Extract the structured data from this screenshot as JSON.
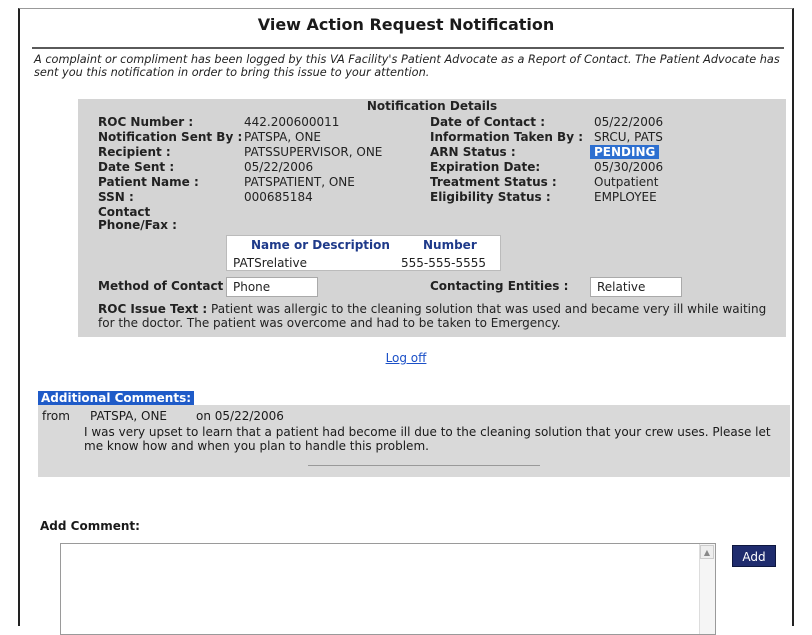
{
  "page": {
    "title": "View Action Request Notification",
    "intro": "A complaint or compliment has been logged by this VA Facility's Patient Advocate as a Report of Contact. The Patient Advocate has sent you this notification in order to bring this issue to your attention."
  },
  "details": {
    "heading": "Notification Details",
    "roc_number_label": "ROC Number :",
    "roc_number": "442.200600011",
    "sent_by_label": "Notification Sent By :",
    "sent_by": "PATSPA, ONE",
    "recipient_label": "Recipient :",
    "recipient": "PATSSUPERVISOR, ONE",
    "date_sent_label": "Date Sent :",
    "date_sent": "05/22/2006",
    "patient_name_label": "Patient Name :",
    "patient_name": "PATSPATIENT, ONE",
    "ssn_label": "SSN :",
    "ssn": "000685184",
    "contact_label_1": "Contact",
    "contact_label_2": "Phone/Fax :",
    "date_of_contact_label": "Date of Contact :",
    "date_of_contact": "05/22/2006",
    "info_taken_by_label": "Information Taken By :",
    "info_taken_by": "SRCU, PATS",
    "arn_status_label": "ARN Status :",
    "arn_status": "PENDING",
    "expiration_label": "Expiration Date:",
    "expiration": "05/30/2006",
    "treatment_label": "Treatment Status :",
    "treatment": "Outpatient",
    "eligibility_label": "Eligibility Status :",
    "eligibility": "EMPLOYEE",
    "contact_table": {
      "col_name": "Name or Description",
      "col_number": "Number",
      "name": "PATSrelative",
      "number": "555-555-5555"
    },
    "method_label": "Method of Contact :",
    "method": "Phone",
    "entities_label": "Contacting Entities :",
    "entities": "Relative",
    "issue_label": "ROC Issue Text :",
    "issue_text": " Patient was allergic to the cleaning solution that was used and became very ill while waiting for the doctor. The patient was overcome and had to be taken to Emergency."
  },
  "logoff": "Log off",
  "comments": {
    "label": "Additional Comments:",
    "from_label": "from",
    "author": "PATSPA, ONE",
    "date": "on 05/22/2006",
    "text": "I was very upset to learn that a patient had become ill due to the cleaning solution that your crew uses. Please let me know how and when you plan to handle this problem."
  },
  "add_comment": {
    "label": "Add Comment:",
    "value": "",
    "button": "Add"
  },
  "colors": {
    "panel": "#d4d4d4",
    "status_badge": "#2d6fd0",
    "header_text": "#1e3a8a",
    "add_button": "#1f2c6e"
  }
}
